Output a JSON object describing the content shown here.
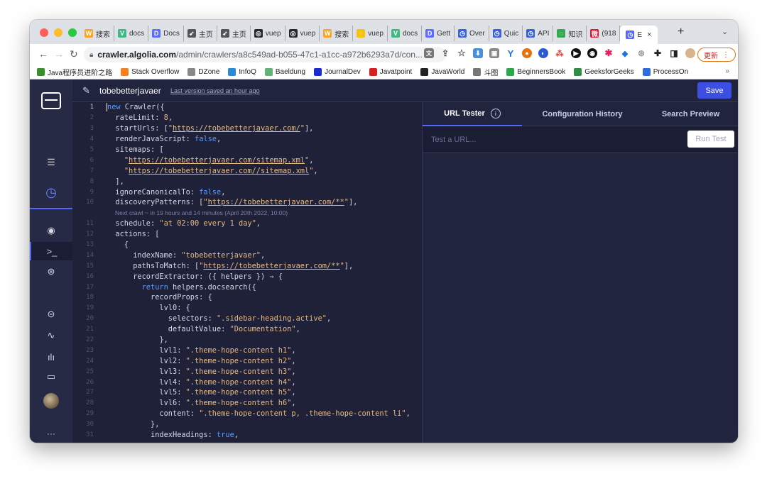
{
  "browser": {
    "tabs": [
      {
        "label": "搜索",
        "icon": "search-w-icon",
        "color": "#f5a623"
      },
      {
        "label": "docs",
        "icon": "vue-icon",
        "color": "#41b883"
      },
      {
        "label": "Docs",
        "icon": "docs-icon",
        "color": "#5b6cff"
      },
      {
        "label": "主页",
        "icon": "rocket-icon",
        "color": "#555555"
      },
      {
        "label": "主页",
        "icon": "rocket-icon",
        "color": "#555555"
      },
      {
        "label": "vuep",
        "icon": "github-icon",
        "color": "#24292e"
      },
      {
        "label": "vuep",
        "icon": "github-icon",
        "color": "#24292e"
      },
      {
        "label": "搜索",
        "icon": "search-w-icon",
        "color": "#f5a623"
      },
      {
        "label": "vuep",
        "icon": "bolt-icon",
        "color": "#f4c20d"
      },
      {
        "label": "docs",
        "icon": "vue-icon",
        "color": "#41b883"
      },
      {
        "label": "Gett",
        "icon": "docs-icon",
        "color": "#5b6cff"
      },
      {
        "label": "Over",
        "icon": "algolia-icon",
        "color": "#3a5fe5"
      },
      {
        "label": "Quic",
        "icon": "algolia-icon",
        "color": "#3a5fe5"
      },
      {
        "label": "API",
        "icon": "algolia-icon",
        "color": "#3a5fe5"
      },
      {
        "label": "知识",
        "icon": "loading-icon",
        "color": "#34a853"
      },
      {
        "label": "(918",
        "icon": "weibo-icon",
        "color": "#e6162d"
      }
    ],
    "active_tab": {
      "label": "E",
      "close": "×"
    },
    "new_tab": "+",
    "tab_menu": "⌄",
    "url_host": "crawler.algolia.com",
    "url_path": "/admin/crawlers/a8c549ad-b055-47c1-a1cc-a972b6293a7d/con...",
    "update_label": "更新",
    "bookmarks": [
      {
        "label": "Java程序员进阶之路",
        "color": "#3c8d2f"
      },
      {
        "label": "Stack Overflow",
        "color": "#f48024"
      },
      {
        "label": "DZone",
        "color": "#888888"
      },
      {
        "label": "InfoQ",
        "color": "#2a8bd4"
      },
      {
        "label": "Baeldung",
        "color": "#63b175"
      },
      {
        "label": "JournalDev",
        "color": "#1c2bd0"
      },
      {
        "label": "Javatpoint",
        "color": "#d6201f"
      },
      {
        "label": "JavaWorld",
        "color": "#222222"
      },
      {
        "label": "斗图",
        "color": "#777777"
      },
      {
        "label": "BeginnersBook",
        "color": "#2ba84a"
      },
      {
        "label": "GeeksforGeeks",
        "color": "#2f8d46"
      },
      {
        "label": "ProcessOn",
        "color": "#2c6ce0"
      }
    ],
    "bookmarks_more": "»"
  },
  "editor": {
    "project_name": "tobebetterjavaer",
    "last_saved": "Last version saved an hour ago",
    "save_label": "Save",
    "next_crawl_hint": "Next crawl ~ in 19 hours and 14 minutes (April 20th 2022, 10:00)"
  },
  "right_panel": {
    "tabs": [
      "URL Tester",
      "Configuration History",
      "Search Preview"
    ],
    "url_placeholder": "Test a URL...",
    "run_label": "Run Test"
  },
  "colors": {
    "accent": "#5468ff",
    "save_button": "#3c4fe0",
    "keyword": "#5a9bff",
    "string": "#e7b984"
  }
}
